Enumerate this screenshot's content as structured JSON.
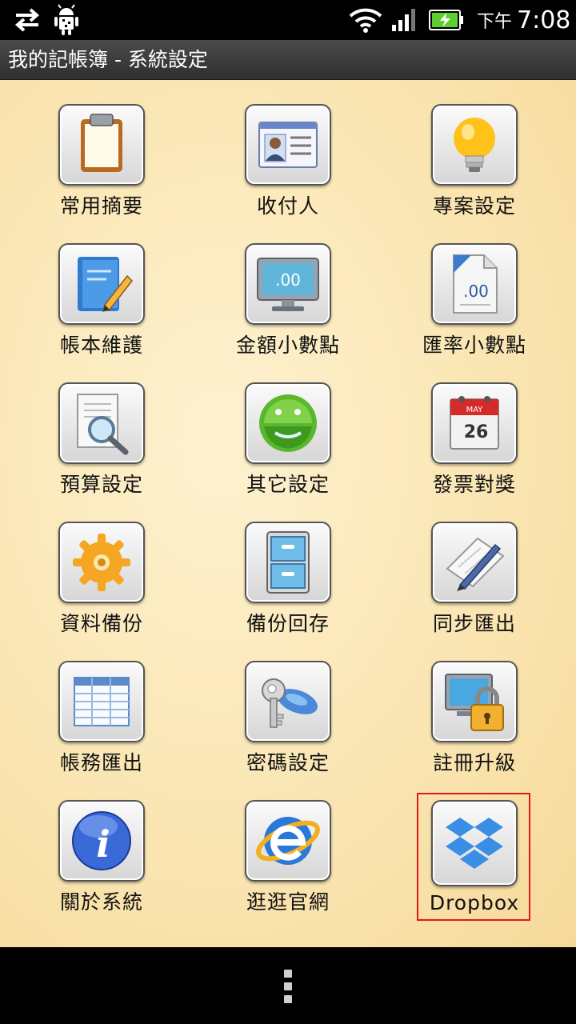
{
  "status_bar": {
    "am_pm": "下午",
    "time": "7:08"
  },
  "title_bar": {
    "title": "我的記帳簿 - 系統設定"
  },
  "tiles": [
    {
      "label": "常用摘要",
      "icon": "clipboard-icon"
    },
    {
      "label": "收付人",
      "icon": "contact-card-icon"
    },
    {
      "label": "專案設定",
      "icon": "lightbulb-icon"
    },
    {
      "label": "帳本維護",
      "icon": "notebook-pencil-icon"
    },
    {
      "label": "金額小數點",
      "icon": "monitor-decimal-icon"
    },
    {
      "label": "匯率小數點",
      "icon": "document-decimal-icon"
    },
    {
      "label": "預算設定",
      "icon": "document-magnifier-icon"
    },
    {
      "label": "其它設定",
      "icon": "android-robot-icon"
    },
    {
      "label": "發票對獎",
      "icon": "calendar-icon"
    },
    {
      "label": "資料備份",
      "icon": "gear-icon"
    },
    {
      "label": "備份回存",
      "icon": "file-cabinet-icon"
    },
    {
      "label": "同步匯出",
      "icon": "notepad-pen-icon"
    },
    {
      "label": "帳務匯出",
      "icon": "spreadsheet-icon"
    },
    {
      "label": "密碼設定",
      "icon": "key-icon"
    },
    {
      "label": "註冊升級",
      "icon": "computer-lock-icon"
    },
    {
      "label": "關於系統",
      "icon": "info-icon"
    },
    {
      "label": "逛逛官網",
      "icon": "web-browser-icon"
    },
    {
      "label": "Dropbox",
      "icon": "dropbox-icon"
    }
  ],
  "colors": {
    "background": "#fbe8b8",
    "highlight": "#e01818",
    "battery": "#5fce2f"
  }
}
